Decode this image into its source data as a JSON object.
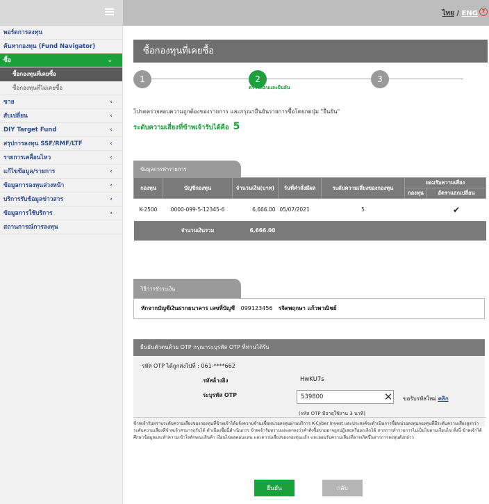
{
  "header": {
    "lang_th": "ไทย",
    "lang_sep": " / ",
    "lang_en": "ENG",
    "help_glyph": "?"
  },
  "sidebar": {
    "items": [
      {
        "label": "พอร์ตการลงทุน"
      },
      {
        "label": "ค้นหากองทุน (Fund Navigator)"
      },
      {
        "label": "ซื้อ",
        "chev": "⌄"
      },
      {
        "label": "ขาย",
        "chev": "‹"
      },
      {
        "label": "สับเปลี่ยน",
        "chev": "‹"
      },
      {
        "label": "DIY Target Fund",
        "chev": "‹"
      },
      {
        "label": "สรุปการลงทุน SSF/RMF/LTF",
        "chev": "‹"
      },
      {
        "label": "รายการเคลื่อนไหว",
        "chev": "‹"
      },
      {
        "label": "แก้ไขข้อมูล/รายการ",
        "chev": "‹"
      },
      {
        "label": "ข้อมูลการลงทุนล่วงหน้า",
        "chev": "‹"
      },
      {
        "label": "บริการรับข้อมูลข่าวสาร",
        "chev": "‹"
      },
      {
        "label": "ข้อมูลการใช้บริการ",
        "chev": "‹"
      },
      {
        "label": "สถานการณ์การลงทุน"
      }
    ],
    "sub_items": [
      {
        "label": "ซื้อกองทุนที่เคยซื้อ"
      },
      {
        "label": "ซื้อกองทุนที่ไม่เคยซื้อ"
      }
    ]
  },
  "main": {
    "title": "ซื้อกองทุนที่เคยซื้อ",
    "steps": [
      "1",
      "2",
      "3"
    ],
    "step_label": "ตรวจสอบและยืนยัน",
    "instruction": "โปรดตรวจสอบความถูกต้องของรายการ และกรุณายืนยันรายการซื้อโดยกดปุ่ม \"ยืนยัน\"",
    "risk_label": "ระดับความเสี่ยงที่ข้าพเจ้ารับได้คือ",
    "risk_value": "5"
  },
  "order": {
    "tab_label": "ข้อมูลการทำรายการ",
    "headers": {
      "fund": "กองทุน",
      "account": "บัญชีกองทุน",
      "amount": "จำนวนเงิน(บาท)",
      "date": "วันที่คำสั่งมีผล",
      "risk": "ระดับความเสี่ยงของกองทุน",
      "accept": "ยอมรับความเสี่ยง",
      "accept_fund": "กองทุน",
      "accept_fx": "อัตราแลกเปลี่ยน"
    },
    "row": {
      "fund": "K-2500",
      "account": "0000-099-5-12345-6",
      "amount": "6,666.00",
      "date": "05/07/2021",
      "risk": "5",
      "check": "✔"
    },
    "total_label": "จำนวนเงินรวม",
    "total_value": "6,666.00"
  },
  "payment": {
    "tab_label": "วิธีการชำระเงิน",
    "method": "หักจากบัญชีเงินฝากธนาคาร เลขที่บัญชี",
    "account_no": "099123456",
    "holder": "รจิตพฤกษา แก้วพาณิชย์"
  },
  "otp": {
    "header": "ยืนยันตัวตนด้วย OTP กรุณาระบุรหัส OTP ที่ท่านได้รับ",
    "sent_to": "รหัส OTP ได้ถูกส่งไปที่ : 061-****662",
    "ref_label": "รหัสอ้างอิง",
    "ref_value": "HwKU7s",
    "input_label": "ระบุรหัส OTP",
    "input_value": "539800",
    "clear_glyph": "✕",
    "resend_text": "ขอรับรหัสใหม่",
    "resend_link": "คลิก",
    "note": "(รหัส OTP มีอายุใช้งาน 3 นาที)"
  },
  "disclaimer": "ข้าพเจ้ารับทราบระดับความเสี่ยงของกองทุนที่ข้าพเจ้าได้แจ้งความจำนงซื้อหน่วยลงทุนผ่านบริการ K-Cyber Invest และประสงค์จะดำเนินการซื้อหน่วยลงทุนกองทุนที่มีระดับความเสี่ยงสูงกว่าระดับความเสี่ยงที่ข้าพเจ้าสามารถรับได้ ดำเนื่องซื้อนี้ดำเนินการ ข้าพเจ้ารับทราบและตกลงว่าคำสั่งซื้อขายอาจถูกปฏิเสธหรือยกเลิกได้ หากการทำรายการไม่เป็นไปตามเงื่อนไข ทั้งนี้ ข้าพเจ้าได้ศึกษาข้อมูลและทำความเข้าใจลักษณะสินค้า เงื่อนไขผลตอบแทน และความเสี่ยงของกองทุนแล้ว และยอมรับความเสี่ยงที่อาจเกิดขึ้นจากการลงทุนดังกล่าว",
  "buttons": {
    "confirm": "ยืนยัน",
    "back": "กลับ"
  }
}
